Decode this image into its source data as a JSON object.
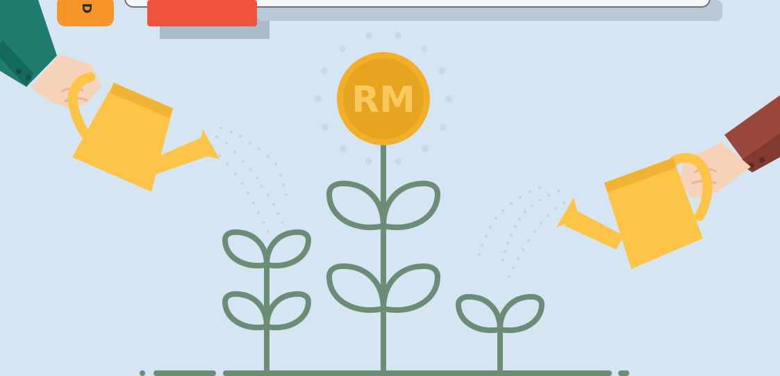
{
  "illustration": {
    "coin": {
      "label": "RM"
    },
    "top_tab": {
      "letter": "D"
    },
    "colors": {
      "background": "#d6e5f2",
      "plant_stem": "#6b8c75",
      "coin_outer": "#f2b02a",
      "coin_inner": "#e6a41f",
      "coin_text": "#f8c95e",
      "watering_can": "#fdc448",
      "watering_can_shade": "#f0b335",
      "left_sleeve": "#1f7d6d",
      "right_sleeve": "#9b483c",
      "skin": "#f6d3b8",
      "water_dots": "#bfd6e7",
      "orange_tab": "#f7952a",
      "red_tab": "#ef533b"
    },
    "icons": [
      "coin-icon",
      "watering-can-icon",
      "hand-icon",
      "plant-icon"
    ]
  }
}
